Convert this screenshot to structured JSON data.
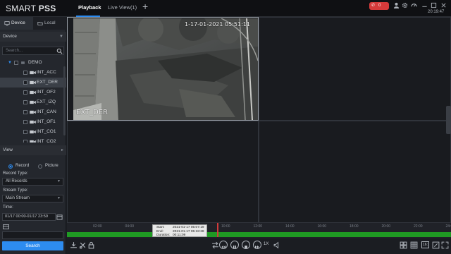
{
  "app": {
    "brand_light": "SMART ",
    "brand_bold": "PSS",
    "tabs": [
      "Playback",
      "Live View(1)"
    ],
    "add_tab": "+",
    "rec_count": "0",
    "clock": "20:19:47"
  },
  "sidebar": {
    "tabs": [
      "Device",
      "Local"
    ],
    "device_section": "Device",
    "search_placeholder": "Search...",
    "tree": {
      "root": "DEMO",
      "channels": [
        "INT_ACC",
        "EXT_DER",
        "INT_OF2",
        "EXT_IZQ",
        "INT_CAN",
        "INT_OF1",
        "INT_CO1",
        "INT_CO2"
      ]
    },
    "view_section": "View",
    "record_label": "Record",
    "picture_label": "Picture",
    "record_type_label": "Record Type:",
    "record_type_value": "All Records",
    "stream_type_label": "Stream Type:",
    "stream_type_value": "Main Stream",
    "time_label": "Time:",
    "time_value": "01/17 00:00-01/17 23:59",
    "search_button": "Search"
  },
  "video": {
    "timestamp_osd": "1-17-01-2021  05:51:11",
    "channel_osd": "EXT_DER"
  },
  "timeline": {
    "ticks": [
      "02:00",
      "04:00",
      "06:00",
      "08:00",
      "10:00",
      "12:00",
      "14:00",
      "16:00",
      "18:00",
      "20:00",
      "22:00",
      "24:00"
    ],
    "tooltip": {
      "start_label": "Start:",
      "start_value": "2021-01-17 05:07:19",
      "end_label": "End:",
      "end_value": "2021-01-17 05:18:28",
      "duration_label": "Duration:",
      "duration_value": "00:11:09"
    }
  },
  "controls": {
    "speed": "1X",
    "ratio": "16:"
  },
  "colors": {
    "accent": "#2d8cf0",
    "record_strip": "#1f9a23",
    "playhead": "#d23b3b",
    "badge_red": "#d53a3a"
  }
}
